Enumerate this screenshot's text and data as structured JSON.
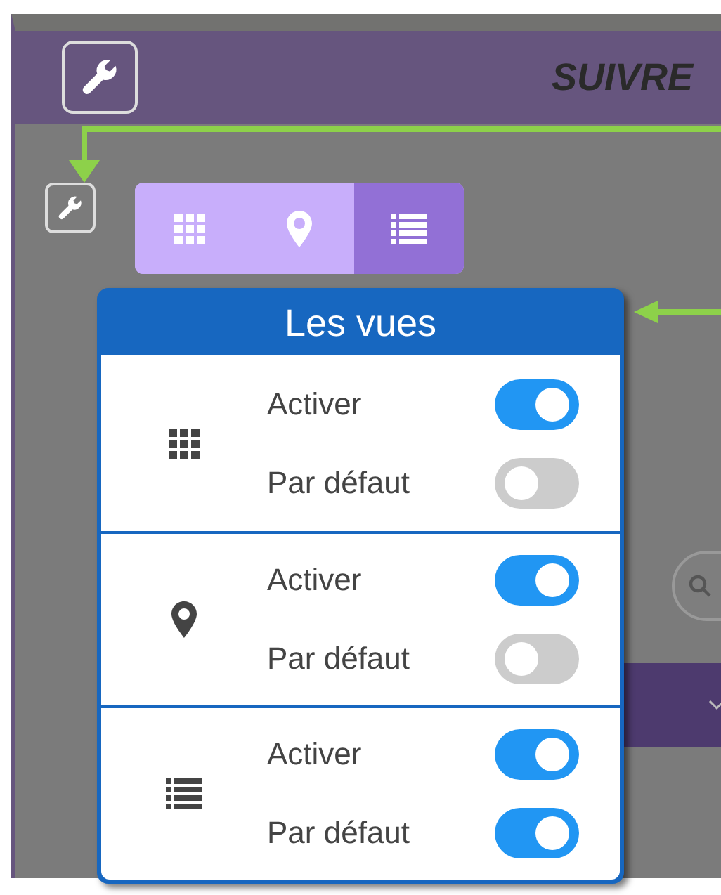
{
  "header": {
    "title": "SUIVRE"
  },
  "view_buttons": [
    {
      "kind": "grid",
      "selected": false
    },
    {
      "kind": "pin",
      "selected": false
    },
    {
      "kind": "list",
      "selected": true
    }
  ],
  "popup": {
    "title": "Les vues",
    "sections": [
      {
        "kind": "grid",
        "options": [
          {
            "label": "Activer",
            "on": true
          },
          {
            "label": "Par défaut",
            "on": false
          }
        ]
      },
      {
        "kind": "pin",
        "options": [
          {
            "label": "Activer",
            "on": true
          },
          {
            "label": "Par défaut",
            "on": false
          }
        ]
      },
      {
        "kind": "list",
        "options": [
          {
            "label": "Activer",
            "on": true
          },
          {
            "label": "Par défaut",
            "on": true
          }
        ]
      }
    ]
  }
}
